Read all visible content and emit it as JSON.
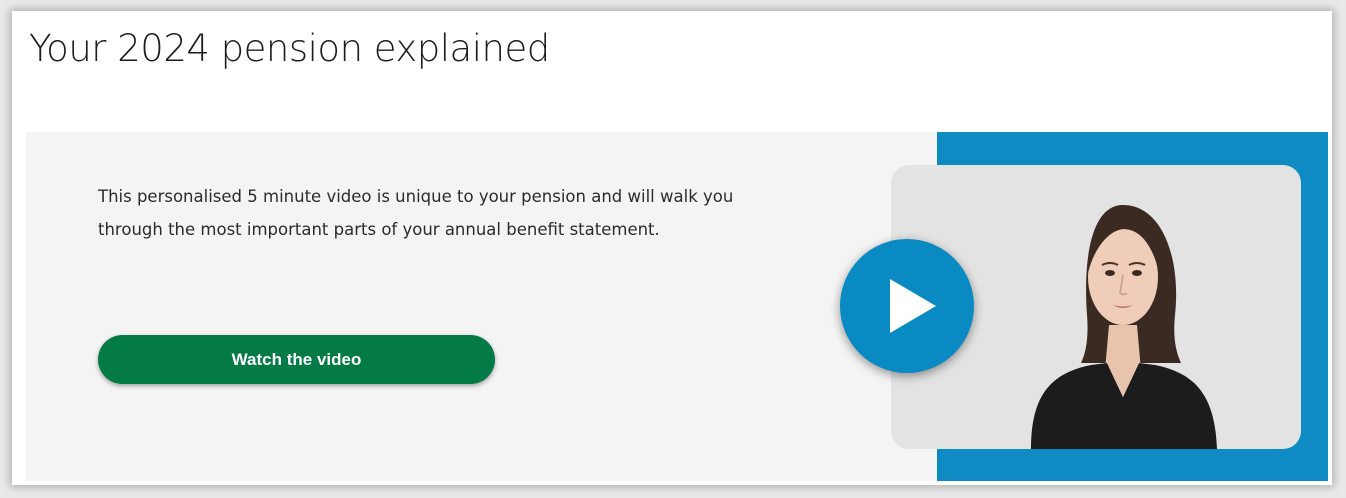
{
  "section": {
    "title": "Your 2024 pension explained"
  },
  "video_panel": {
    "description": "This personalised 5 minute video is unique to your pension and will walk you through the most important parts of your annual benefit statement.",
    "watch_button_label": "Watch the video",
    "play_icon": "play-icon",
    "presenter_image": "presenter-photo"
  },
  "colors": {
    "button_green": "#047a46",
    "accent_blue": "#0f8bc4",
    "play_blue": "#0a8ac3",
    "panel_background": "#f4f4f4"
  }
}
